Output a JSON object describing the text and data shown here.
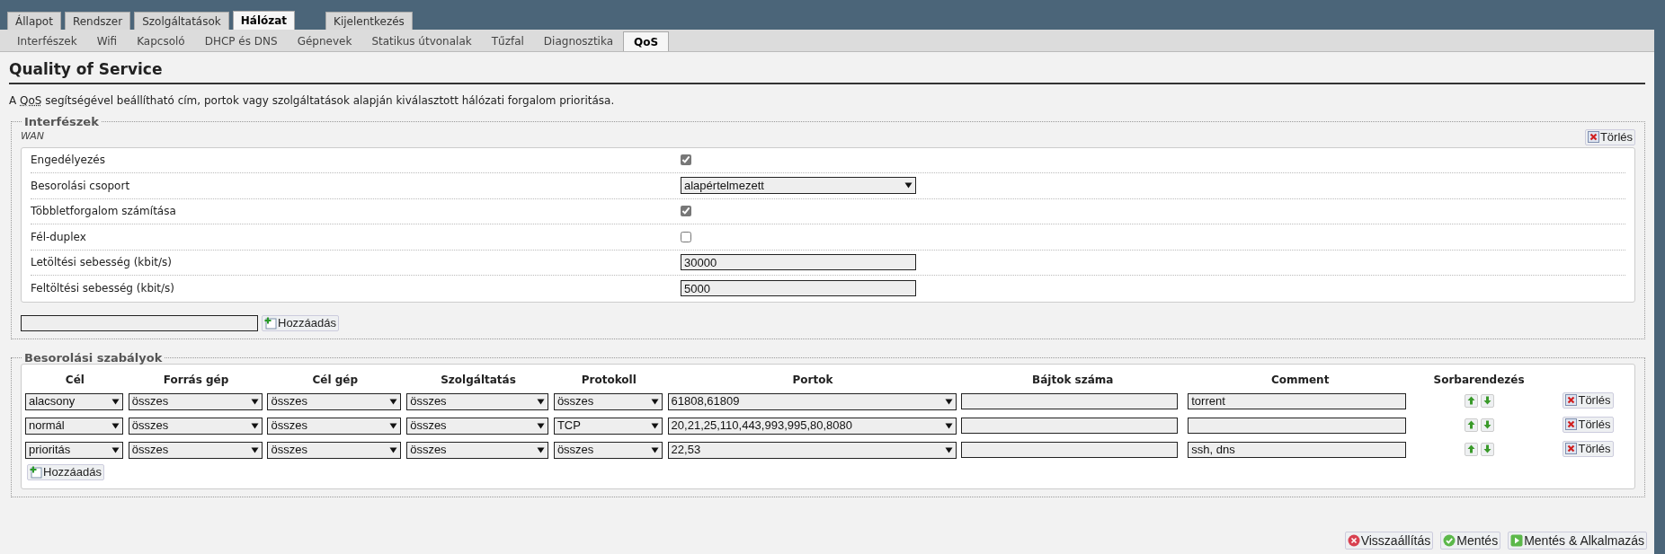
{
  "top_tabs": [
    {
      "label": "Állapot",
      "selected": false
    },
    {
      "label": "Rendszer",
      "selected": false
    },
    {
      "label": "Szolgáltatások",
      "selected": false
    },
    {
      "label": "Hálózat",
      "selected": true
    }
  ],
  "logout_tab": {
    "label": "Kijelentkezés"
  },
  "sub_tabs": [
    {
      "label": "Interfészek",
      "selected": false
    },
    {
      "label": "Wifi",
      "selected": false
    },
    {
      "label": "Kapcsoló",
      "selected": false
    },
    {
      "label": "DHCP és DNS",
      "selected": false
    },
    {
      "label": "Gépnevek",
      "selected": false
    },
    {
      "label": "Statikus útvonalak",
      "selected": false
    },
    {
      "label": "Tűzfal",
      "selected": false
    },
    {
      "label": "Diagnosztika",
      "selected": false
    },
    {
      "label": "QoS",
      "selected": true
    }
  ],
  "page": {
    "title": "Quality of Service",
    "description": {
      "before": "A ",
      "abbr": "QoS",
      "after": " segítségével beállítható cím, portok vagy szolgáltatások alapján kiválasztott hálózati forgalom prioritása."
    }
  },
  "interfaces": {
    "legend": "Interfészek",
    "sections": [
      {
        "name": "WAN",
        "delete_label": "Törlés",
        "options": [
          {
            "kind": "checkbox",
            "label": "Engedélyezés",
            "checked": true
          },
          {
            "kind": "select",
            "label": "Besorolási csoport",
            "value": "alapértelmezett"
          },
          {
            "kind": "checkbox",
            "label": "Többletforgalom számítása",
            "checked": true
          },
          {
            "kind": "checkbox",
            "label": "Fél-duplex",
            "checked": false
          },
          {
            "kind": "text",
            "label": "Letöltési sebesség (kbit/s)",
            "value": "30000"
          },
          {
            "kind": "text",
            "label": "Feltöltési sebesség (kbit/s)",
            "value": "5000"
          }
        ]
      }
    ],
    "add_button": "Hozzáadás"
  },
  "rules": {
    "legend": "Besorolási szabályok",
    "columns": [
      "Cél",
      "Forrás gép",
      "Cél gép",
      "Szolgáltatás",
      "Protokoll",
      "Portok",
      "Bájtok száma",
      "Comment",
      "Sorbarendezés"
    ],
    "rows": [
      {
        "target": "alacsony",
        "source": "összes",
        "destination": "összes",
        "service": "összes",
        "protocol": "összes",
        "ports": "61808,61809",
        "comment": "torrent",
        "delete_label": "Törlés"
      },
      {
        "target": "normál",
        "source": "összes",
        "destination": "összes",
        "service": "összes",
        "protocol": "TCP",
        "ports": "20,21,25,110,443,993,995,80,8080",
        "delete_label": "Törlés"
      },
      {
        "target": "prioritás",
        "source": "összes",
        "destination": "összes",
        "service": "összes",
        "protocol": "összes",
        "ports": "22,53",
        "comment": "ssh, dns",
        "delete_label": "Törlés"
      }
    ],
    "add_button": "Hozzáadás"
  },
  "actions": [
    {
      "kind": "reset",
      "label": "Visszaállítás"
    },
    {
      "kind": "save",
      "label": "Mentés"
    },
    {
      "kind": "apply",
      "label": "Mentés & Alkalmazás"
    }
  ]
}
